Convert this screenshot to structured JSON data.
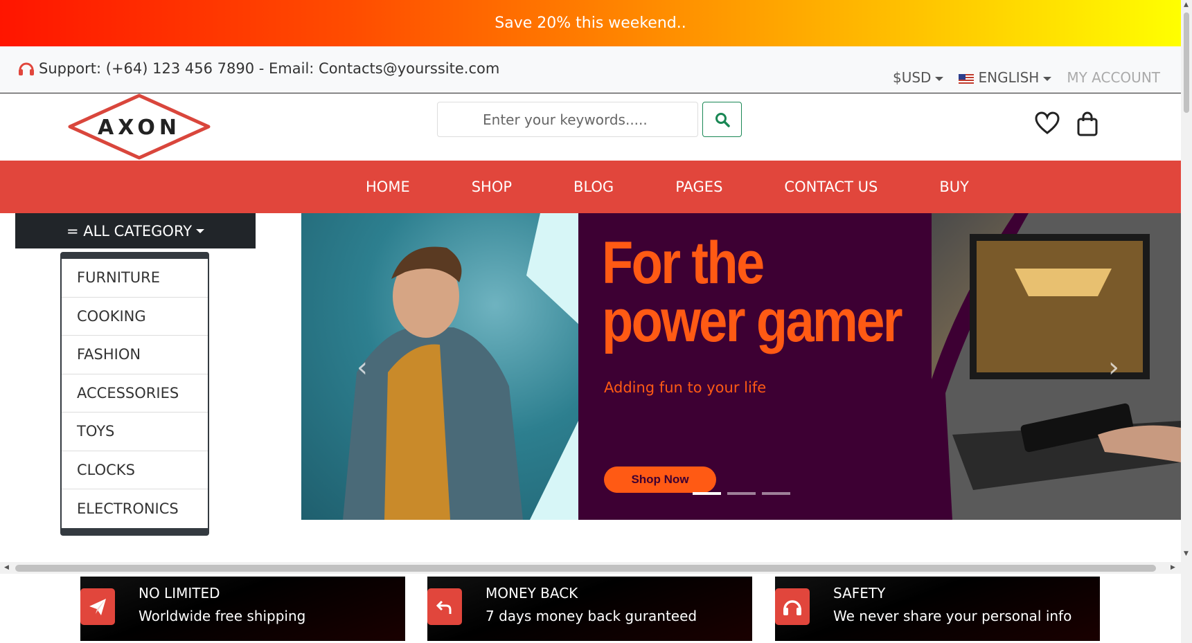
{
  "promo": {
    "text": "Save 20% this weekend.."
  },
  "support": {
    "text": "Support: (+64) 123 456 7890 - Email: Contacts@yourssite.com",
    "currency": "$USD",
    "language": "ENGLISH",
    "account": "MY ACCOUNT"
  },
  "header": {
    "logo_text": "AXON",
    "search_placeholder": "Enter your keywords.....",
    "icons": [
      "search-icon",
      "heart-icon",
      "bag-icon"
    ]
  },
  "nav": {
    "items": [
      "HOME",
      "SHOP",
      "BLOG",
      "PAGES",
      "CONTACT US",
      "BUY"
    ]
  },
  "category": {
    "button_label": "= ALL CATEGORY",
    "items": [
      "FURNITURE",
      "COOKING",
      "FASHION",
      "ACCESSORIES",
      "TOYS",
      "CLOCKS",
      "ELECTRONICS"
    ]
  },
  "hero": {
    "title_line1": "For the",
    "title_line2": "power gamer",
    "subtitle": "Adding fun to your life",
    "cta": "Shop Now",
    "slides": 3,
    "active_slide": 1
  },
  "features": [
    {
      "title": "NO LIMITED",
      "text": "Worldwide free shipping",
      "icon": "paper-plane-icon"
    },
    {
      "title": "MONEY BACK",
      "text": "7 days money back guranteed",
      "icon": "undo-arrow-icon"
    },
    {
      "title": "SAFETY",
      "text": "We never share your personal info",
      "icon": "headphones-icon"
    }
  ],
  "colors": {
    "accent": "#e1463c",
    "hero_bg": "#3d0033",
    "hero_text": "#ff5a14",
    "dark": "#212529"
  }
}
